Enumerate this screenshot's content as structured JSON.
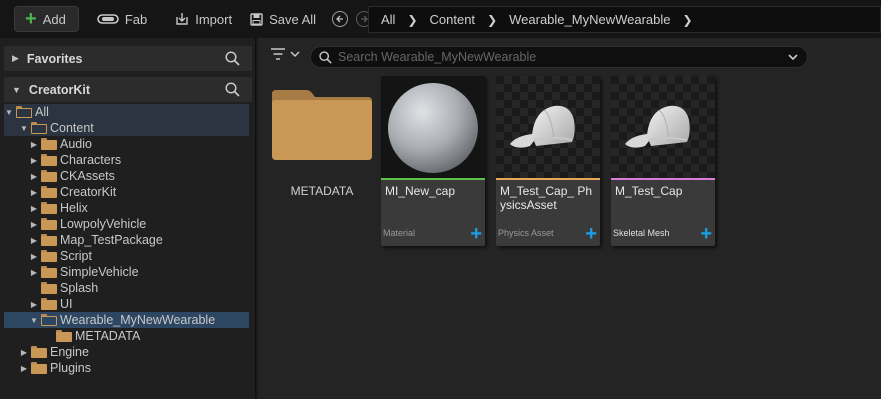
{
  "toolbar": {
    "add_label": "Add",
    "fab_label": "Fab",
    "import_label": "Import",
    "save_all_label": "Save All"
  },
  "breadcrumb": [
    "All",
    "Content",
    "Wearable_MyNewWearable"
  ],
  "left_panel": {
    "favorites_label": "Favorites",
    "creatorkit_label": "CreatorKit",
    "tree": [
      {
        "label": "All",
        "depth": 0,
        "expanded": true,
        "open": true
      },
      {
        "label": "Content",
        "depth": 1,
        "expanded": true,
        "open": true
      },
      {
        "label": "Audio",
        "depth": 2,
        "expanded": false
      },
      {
        "label": "Characters",
        "depth": 2,
        "expanded": false
      },
      {
        "label": "CKAssets",
        "depth": 2,
        "expanded": false
      },
      {
        "label": "CreatorKit",
        "depth": 2,
        "expanded": false
      },
      {
        "label": "Helix",
        "depth": 2,
        "expanded": false
      },
      {
        "label": "LowpolyVehicle",
        "depth": 2,
        "expanded": false
      },
      {
        "label": "Map_TestPackage",
        "depth": 2,
        "expanded": false
      },
      {
        "label": "Script",
        "depth": 2,
        "expanded": false
      },
      {
        "label": "SimpleVehicle",
        "depth": 2,
        "expanded": false
      },
      {
        "label": "Splash",
        "depth": 2,
        "expanded": null
      },
      {
        "label": "UI",
        "depth": 2,
        "expanded": false
      },
      {
        "label": "Wearable_MyNewWearable",
        "depth": 2,
        "expanded": true,
        "open": true,
        "selected": true
      },
      {
        "label": "METADATA",
        "depth": 3,
        "expanded": null
      },
      {
        "label": "Engine",
        "depth": 1,
        "expanded": false
      },
      {
        "label": "Plugins",
        "depth": 1,
        "expanded": false
      }
    ]
  },
  "search": {
    "placeholder": "Search Wearable_MyNewWearable"
  },
  "assets": [
    {
      "name": "METADATA",
      "kind": "folder"
    },
    {
      "name": "MI_New_cap",
      "type": "Material",
      "strip_color": "#5bc24a",
      "thumb": "sphere"
    },
    {
      "name": "M_Test_Cap_ PhysicsAsset",
      "type": "Physics Asset",
      "strip_color": "#e8a858",
      "thumb": "cap"
    },
    {
      "name": "M_Test_Cap",
      "type": "Skeletal Mesh",
      "strip_color": "#d77ed9",
      "thumb": "cap"
    }
  ],
  "colors": {
    "selection": "#2d4662",
    "accent_plus": "#1aa0e8",
    "add_plus": "#4cb54c",
    "folder": "#c99856"
  }
}
